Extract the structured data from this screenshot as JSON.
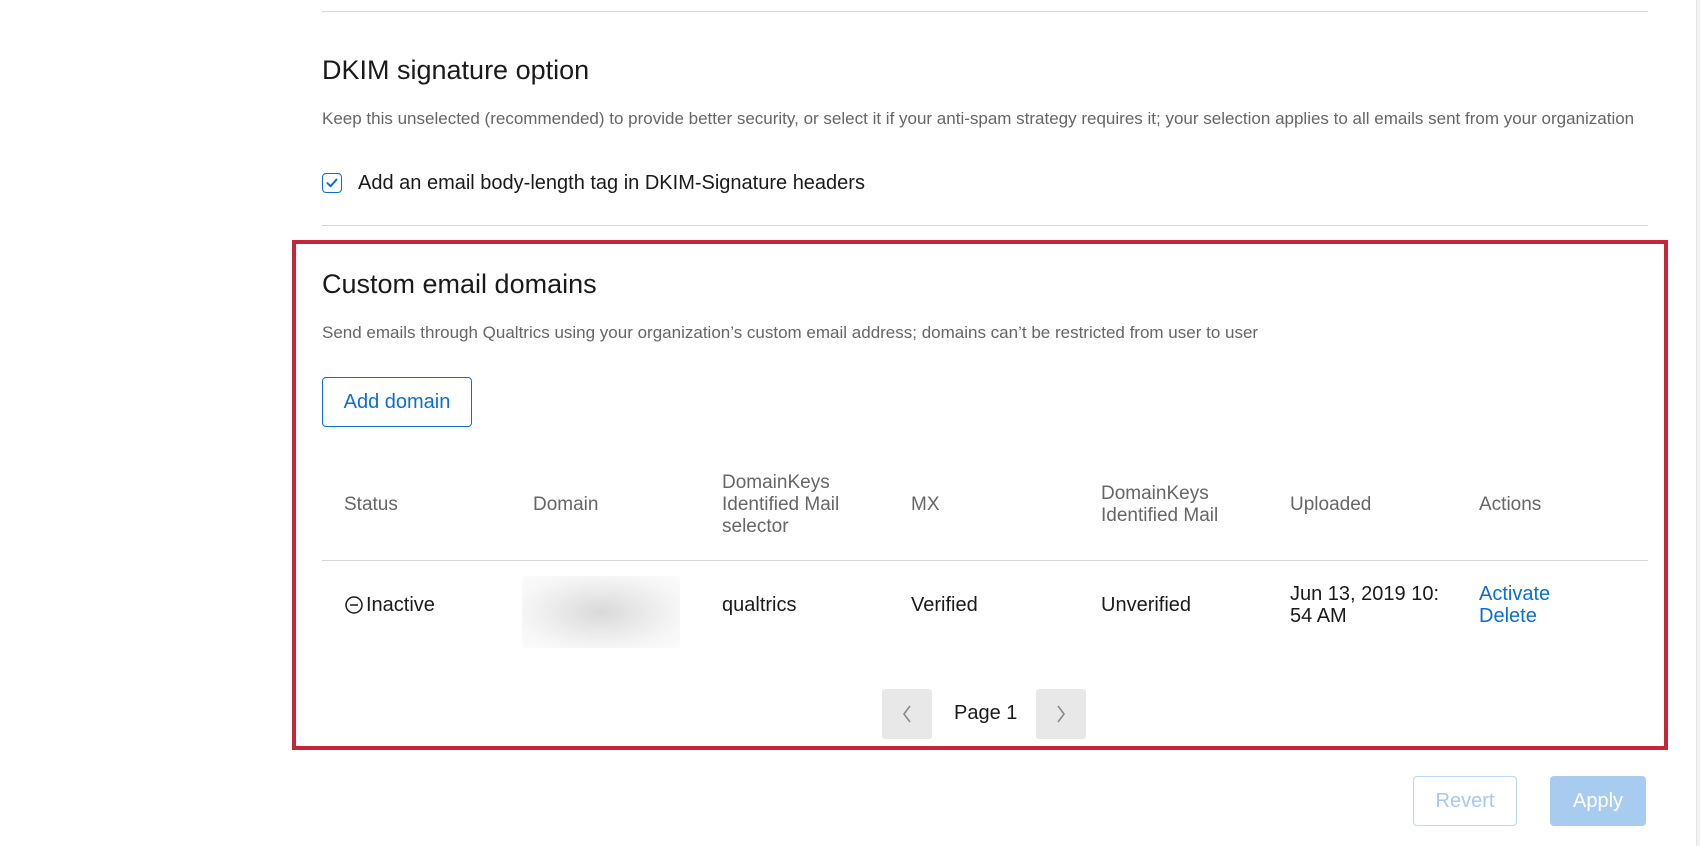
{
  "dkim_section": {
    "title": "DKIM signature option",
    "description": "Keep this unselected (recommended) to provide better security, or select it if your anti-spam strategy requires it; your selection applies to all emails sent from your organization",
    "checkbox_label": "Add an email body-length tag in DKIM-Signature headers",
    "checkbox_checked": true
  },
  "custom_domains": {
    "title": "Custom email domains",
    "description": "Send emails through Qualtrics using your organization’s custom email address; domains can’t be restricted from user to user",
    "add_button_label": "Add domain",
    "table": {
      "headers": {
        "status": "Status",
        "domain": "Domain",
        "dkim_selector": [
          "DomainKeys",
          "Identified Mail",
          "selector"
        ],
        "mx": "MX",
        "dkim": [
          "DomainKeys",
          "Identified Mail"
        ],
        "uploaded": "Uploaded",
        "actions": "Actions"
      },
      "rows": [
        {
          "status": "Inactive",
          "status_icon": "minus-circle-icon",
          "domain": "",
          "dkim_selector": "qualtrics",
          "mx": "Verified",
          "dkim": "Unverified",
          "uploaded": [
            "Jun 13, 2019 10:",
            "54 AM"
          ],
          "actions": [
            "Activate",
            "Delete"
          ]
        }
      ]
    },
    "pagination": {
      "page_label": "Page 1",
      "prev_icon": "chevron-left-icon",
      "next_icon": "chevron-right-icon"
    }
  },
  "footer": {
    "revert_label": "Revert",
    "apply_label": "Apply"
  },
  "colors": {
    "accent": "#0b6ed0",
    "highlight_frame": "#c8253b",
    "muted_text": "#666666",
    "disabled_apply": "#a8ccf0"
  }
}
